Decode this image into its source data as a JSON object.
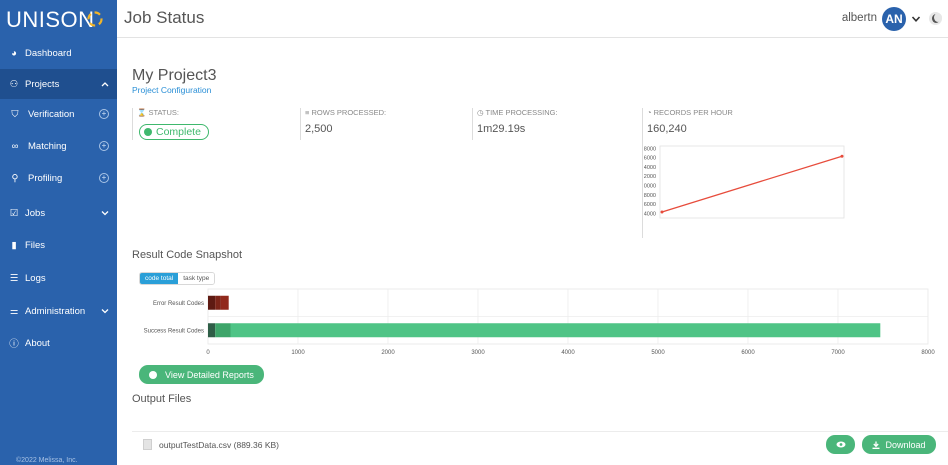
{
  "app": {
    "logo_text": "UNISON",
    "page_title": "Job Status",
    "copyright": "©2022 Melissa, Inc."
  },
  "header": {
    "user_name": "albertn",
    "avatar_initials": "AN"
  },
  "sidebar": {
    "items": [
      {
        "label": "Dashboard",
        "icon": "dashboard-icon"
      },
      {
        "label": "Projects",
        "icon": "users-icon",
        "trail": "^"
      },
      {
        "label": "Verification",
        "icon": "shield-icon",
        "trail": "+"
      },
      {
        "label": "Matching",
        "icon": "binoculars-icon",
        "trail": "+"
      },
      {
        "label": "Profiling",
        "icon": "magnifier-icon",
        "trail": "+"
      },
      {
        "label": "Jobs",
        "icon": "checkbox-icon",
        "trail": "v"
      },
      {
        "label": "Files",
        "icon": "file-icon"
      },
      {
        "label": "Logs",
        "icon": "list-icon"
      },
      {
        "label": "Administration",
        "icon": "sliders-icon",
        "trail": "v"
      },
      {
        "label": "About",
        "icon": "info-icon"
      }
    ]
  },
  "project": {
    "name": "My Project3",
    "config_link": "Project Configuration"
  },
  "stats": {
    "status_label": "STATUS:",
    "status_value": "Complete",
    "rows_label": "ROWS PROCESSED:",
    "rows_value": "2,500",
    "time_label": "TIME PROCESSING:",
    "time_value": "1m29.19s",
    "rph_label": "RECORDS PER HOUR",
    "rph_value": "160,240"
  },
  "result_snapshot": {
    "title": "Result Code Snapshot",
    "toggle_code_total": "code total",
    "toggle_task_type": "task type"
  },
  "buttons": {
    "view_reports": "View Detailed Reports",
    "download": "Download"
  },
  "output": {
    "title": "Output Files",
    "file_name": "outputTestData.csv (889.36 KB)"
  },
  "chart_data": [
    {
      "type": "line",
      "y_ticks": [
        4000,
        6000,
        8000,
        10000,
        12000,
        14000,
        16000,
        18000
      ],
      "ylim": [
        3000,
        18500
      ],
      "series": [
        {
          "values": [
            4300,
            16300
          ],
          "color": "#e74c3c"
        }
      ],
      "grid": false
    },
    {
      "type": "bar",
      "orientation": "horizontal",
      "stacked": true,
      "categories": [
        "Error Result Codes",
        "Success Result Codes"
      ],
      "x_ticks": [
        0,
        1000,
        2000,
        3000,
        4000,
        5000,
        6000,
        7000,
        8000
      ],
      "xlim": [
        0,
        8000
      ],
      "series": [
        {
          "values": [
            80,
            80
          ],
          "color": "#5e1a12"
        },
        {
          "values": [
            60,
            170
          ],
          "color": "#2f5e47"
        },
        {
          "values": [
            90,
            7220
          ],
          "color": "#4fc486"
        }
      ],
      "colors_error": [
        "#5e1a12",
        "#7c2418",
        "#91291c"
      ],
      "colors_success": [
        "#2f5e47",
        "#3ea56a",
        "#4fc486"
      ],
      "grid": true
    }
  ]
}
